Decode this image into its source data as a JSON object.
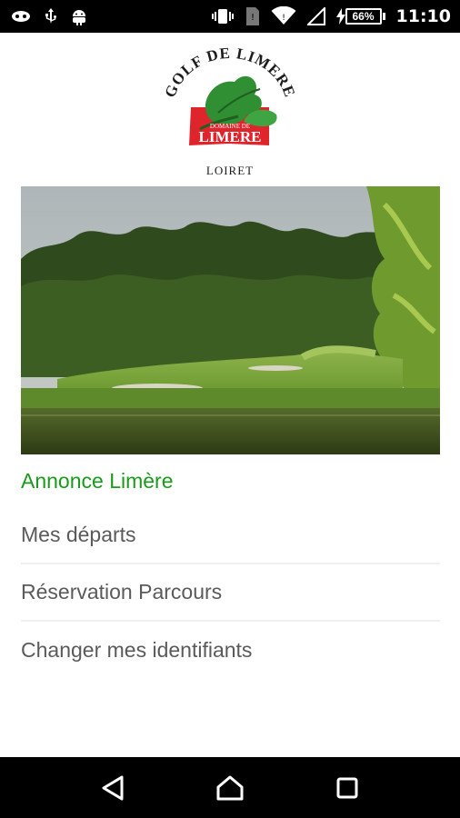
{
  "status_bar": {
    "battery_level": "66%",
    "time": "11:10"
  },
  "logo": {
    "arc_text": "GOLF DE LIMERE",
    "banner_small": "DOMAINE DE",
    "banner_text": "LIMERE",
    "bottom_text": "LOIRET"
  },
  "menu": {
    "items": [
      {
        "label": "Annonce Limère",
        "active": true
      },
      {
        "label": "Mes départs",
        "active": false
      },
      {
        "label": "Réservation Parcours",
        "active": false
      },
      {
        "label": "Changer mes identifiants",
        "active": false
      }
    ]
  },
  "colors": {
    "accent_green": "#1a9a1a",
    "menu_text": "#5a5a5a",
    "logo_red": "#e0242c"
  }
}
